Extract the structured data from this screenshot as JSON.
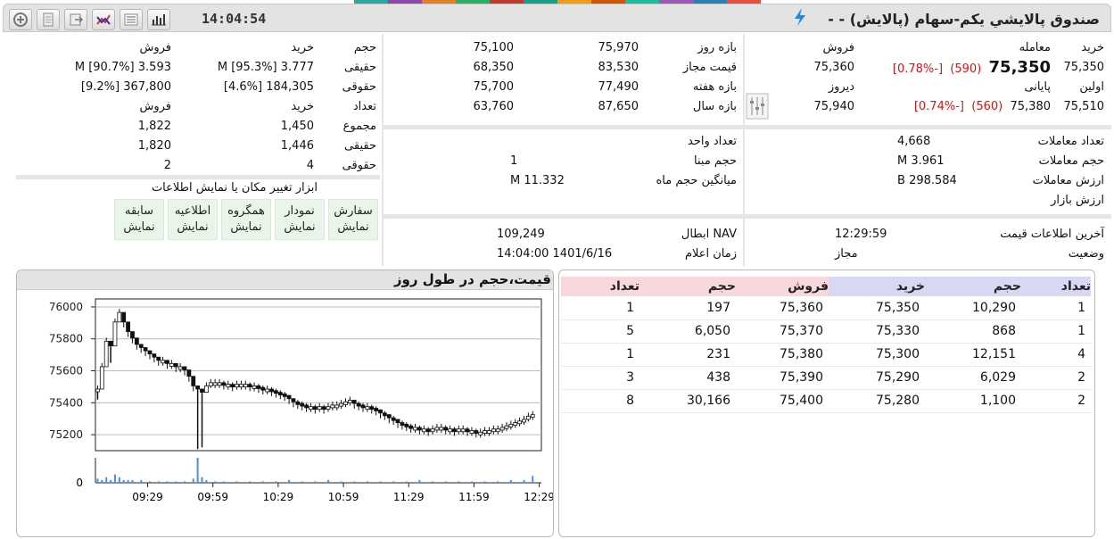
{
  "colors": {
    "accent_stripe": [
      "#2aa7a1",
      "#8e44ad",
      "#e67e22",
      "#27ae60",
      "#c0392b",
      "#16a085",
      "#f39c12",
      "#d35400",
      "#1abc9c",
      "#9b59b6",
      "#2980b9",
      "#e74c3c"
    ],
    "negative": "#dd1111",
    "buy_header": "#d8d8f4",
    "sell_header": "#f8d8dc",
    "show_button": "#e8f5e8"
  },
  "titlebar": {
    "time": "14:04:54",
    "title": "صندوق پالايشي يكم-سهام (پالايش) - -",
    "icons": [
      "add-icon",
      "document-icon",
      "export-icon",
      "chart-compare-icon",
      "list-icon",
      "bar-chart-icon"
    ],
    "bolt_icon": "lightning-icon"
  },
  "price": {
    "labels": {
      "buy": "خرید",
      "trade": "معامله",
      "sell": "فروش",
      "first": "اولین",
      "last": "پایانی",
      "yesterday": "دیروز"
    },
    "buy": "75,350",
    "trade": "75,350",
    "trade_change": "(590)",
    "trade_pct": "[-0.78%]",
    "sell": "75,360",
    "first": "75,510",
    "last": "75,380",
    "last_change": "(560)",
    "last_pct": "[-0.74%]",
    "yesterday": "75,940"
  },
  "ranges": {
    "rows": [
      {
        "label": "بازه روز",
        "v1": "75,970",
        "v2": "75,100"
      },
      {
        "label": "قیمت مجاز",
        "v1": "83,530",
        "v2": "68,350"
      },
      {
        "label": "بازه هفته",
        "v1": "77,490",
        "v2": "75,700"
      },
      {
        "label": "بازه سال",
        "v1": "87,650",
        "v2": "63,760"
      }
    ]
  },
  "clients": {
    "header": {
      "volume": "حجم",
      "buy": "خرید",
      "sell": "فروش"
    },
    "rows": [
      {
        "label": "حقیقی",
        "buy": "3.777 M [95.3%]",
        "sell": "3.593 M [90.7%]"
      },
      {
        "label": "حقوقی",
        "buy": "184,305 [4.6%]",
        "sell": "367,800 [9.2%]"
      }
    ],
    "count_header": {
      "count": "تعداد",
      "buy": "خرید",
      "sell": "فروش"
    },
    "count_rows": [
      {
        "label": "مجموع",
        "buy": "1,450",
        "sell": "1,822"
      },
      {
        "label": "حقیقی",
        "buy": "1,446",
        "sell": "1,820"
      },
      {
        "label": "حقوقی",
        "buy": "4",
        "sell": "2"
      }
    ]
  },
  "tools": {
    "title": "ابزار تغییر مکان یا نمایش اطلاعات",
    "buttons": [
      {
        "name": "سفارش",
        "action": "نمایش"
      },
      {
        "name": "نمودار",
        "action": "نمایش"
      },
      {
        "name": "همگروه",
        "action": "نمایش"
      },
      {
        "name": "اطلاعیه",
        "action": "نمایش"
      },
      {
        "name": "سابقه",
        "action": "نمایش"
      }
    ]
  },
  "trades": {
    "rows": [
      {
        "label": "تعداد معاملات",
        "value": "4,668"
      },
      {
        "label": "حجم معاملات",
        "value": "3.961 M"
      },
      {
        "label": "ارزش معاملات",
        "value": "298.584 B"
      },
      {
        "label": "ارزش بازار",
        "value": ""
      }
    ]
  },
  "units": {
    "rows": [
      {
        "label": "تعداد واحد",
        "value": ""
      },
      {
        "label": "حجم مبنا",
        "value": "1"
      },
      {
        "label": "میانگین حجم ماه",
        "value": "11.332 M"
      }
    ]
  },
  "status": {
    "last_price_label": "آخرین اطلاعات قیمت",
    "last_price_value": "12:29:59",
    "state_label": "وضعیت",
    "state_value": "مجاز"
  },
  "nav": {
    "nav_label": "NAV ابطال",
    "nav_value": "109,249",
    "time_label": "زمان اعلام",
    "time_value": "1401/6/16 14:04:00"
  },
  "orderbook": {
    "headers": {
      "count": "تعداد",
      "volume": "حجم",
      "buy": "خرید",
      "sell": "فروش"
    },
    "rows": [
      {
        "bcount": "1",
        "bvol": "10,290",
        "bprice": "75,350",
        "sprice": "75,360",
        "svol": "197",
        "scount": "1"
      },
      {
        "bcount": "1",
        "bvol": "868",
        "bprice": "75,330",
        "sprice": "75,370",
        "svol": "6,050",
        "scount": "5"
      },
      {
        "bcount": "4",
        "bvol": "12,151",
        "bprice": "75,300",
        "sprice": "75,380",
        "svol": "231",
        "scount": "1"
      },
      {
        "bcount": "2",
        "bvol": "6,029",
        "bprice": "75,290",
        "sprice": "75,390",
        "svol": "438",
        "scount": "3"
      },
      {
        "bcount": "2",
        "bvol": "1,100",
        "bprice": "75,280",
        "sprice": "75,400",
        "svol": "30,166",
        "scount": "8"
      }
    ]
  },
  "chart_data": {
    "type": "candlestick",
    "title": "قیمت،حجم در طول روز",
    "xlabel": "",
    "ylabel": "",
    "ylim": [
      75100,
      76050
    ],
    "y_ticks": [
      76000,
      75800,
      75600,
      75400,
      75200
    ],
    "x_ticks": [
      "09:29",
      "09:59",
      "10:29",
      "10:59",
      "11:29",
      "11:59",
      "12:29"
    ],
    "volume_ticks": [
      0
    ],
    "grid": true,
    "x_range_minutes": [
      545,
      750
    ],
    "prices": [
      [
        546,
        75480
      ],
      [
        548,
        75620
      ],
      [
        550,
        75780
      ],
      [
        552,
        75750
      ],
      [
        554,
        75900
      ],
      [
        556,
        75960
      ],
      [
        558,
        75900
      ],
      [
        560,
        75840
      ],
      [
        562,
        75800
      ],
      [
        564,
        75760
      ],
      [
        566,
        75740
      ],
      [
        568,
        75720
      ],
      [
        570,
        75700
      ],
      [
        572,
        75680
      ],
      [
        574,
        75660
      ],
      [
        576,
        75660
      ],
      [
        578,
        75640
      ],
      [
        580,
        75640
      ],
      [
        582,
        75620
      ],
      [
        584,
        75620
      ],
      [
        586,
        75600
      ],
      [
        588,
        75560
      ],
      [
        590,
        75500
      ],
      [
        592,
        75480
      ],
      [
        594,
        75460
      ],
      [
        596,
        75500
      ],
      [
        598,
        75520
      ],
      [
        600,
        75520
      ],
      [
        602,
        75520
      ],
      [
        604,
        75510
      ],
      [
        606,
        75510
      ],
      [
        608,
        75500
      ],
      [
        610,
        75510
      ],
      [
        612,
        75510
      ],
      [
        614,
        75510
      ],
      [
        616,
        75500
      ],
      [
        618,
        75500
      ],
      [
        620,
        75490
      ],
      [
        622,
        75480
      ],
      [
        624,
        75480
      ],
      [
        626,
        75470
      ],
      [
        628,
        75460
      ],
      [
        630,
        75450
      ],
      [
        632,
        75440
      ],
      [
        634,
        75420
      ],
      [
        636,
        75400
      ],
      [
        638,
        75390
      ],
      [
        640,
        75380
      ],
      [
        642,
        75370
      ],
      [
        644,
        75370
      ],
      [
        646,
        75360
      ],
      [
        648,
        75370
      ],
      [
        650,
        75360
      ],
      [
        652,
        75370
      ],
      [
        654,
        75380
      ],
      [
        656,
        75380
      ],
      [
        658,
        75390
      ],
      [
        660,
        75400
      ],
      [
        662,
        75410
      ],
      [
        664,
        75390
      ],
      [
        666,
        75380
      ],
      [
        668,
        75370
      ],
      [
        670,
        75370
      ],
      [
        672,
        75360
      ],
      [
        674,
        75350
      ],
      [
        676,
        75330
      ],
      [
        678,
        75320
      ],
      [
        680,
        75300
      ],
      [
        682,
        75290
      ],
      [
        684,
        75270
      ],
      [
        686,
        75260
      ],
      [
        688,
        75250
      ],
      [
        690,
        75240
      ],
      [
        692,
        75240
      ],
      [
        694,
        75230
      ],
      [
        696,
        75230
      ],
      [
        698,
        75220
      ],
      [
        700,
        75230
      ],
      [
        702,
        75240
      ],
      [
        704,
        75240
      ],
      [
        706,
        75230
      ],
      [
        708,
        75230
      ],
      [
        710,
        75220
      ],
      [
        712,
        75230
      ],
      [
        714,
        75230
      ],
      [
        716,
        75220
      ],
      [
        718,
        75220
      ],
      [
        720,
        75210
      ],
      [
        722,
        75210
      ],
      [
        724,
        75220
      ],
      [
        726,
        75220
      ],
      [
        728,
        75230
      ],
      [
        730,
        75230
      ],
      [
        732,
        75240
      ],
      [
        734,
        75250
      ],
      [
        736,
        75260
      ],
      [
        738,
        75270
      ],
      [
        740,
        75280
      ],
      [
        742,
        75290
      ],
      [
        744,
        75310
      ],
      [
        746,
        75320
      ]
    ],
    "spikes_low": [
      [
        546,
        75420
      ],
      [
        552,
        75650
      ],
      [
        592,
        75110
      ],
      [
        594,
        75120
      ]
    ],
    "volumes": [
      [
        546,
        3
      ],
      [
        548,
        2
      ],
      [
        550,
        4
      ],
      [
        552,
        2
      ],
      [
        554,
        6
      ],
      [
        556,
        4
      ],
      [
        558,
        2
      ],
      [
        560,
        2
      ],
      [
        562,
        2
      ],
      [
        566,
        2
      ],
      [
        570,
        1
      ],
      [
        574,
        1
      ],
      [
        578,
        1
      ],
      [
        582,
        1
      ],
      [
        586,
        1
      ],
      [
        590,
        3
      ],
      [
        592,
        18
      ],
      [
        594,
        4
      ],
      [
        596,
        2
      ],
      [
        600,
        1
      ],
      [
        604,
        1
      ],
      [
        610,
        1
      ],
      [
        616,
        1
      ],
      [
        622,
        1
      ],
      [
        628,
        1
      ],
      [
        634,
        2
      ],
      [
        640,
        1
      ],
      [
        646,
        1
      ],
      [
        652,
        2
      ],
      [
        658,
        1
      ],
      [
        664,
        1
      ],
      [
        670,
        1
      ],
      [
        676,
        1
      ],
      [
        682,
        1
      ],
      [
        688,
        1
      ],
      [
        694,
        2
      ],
      [
        700,
        1
      ],
      [
        706,
        1
      ],
      [
        712,
        1
      ],
      [
        718,
        1
      ],
      [
        724,
        1
      ],
      [
        730,
        1
      ],
      [
        736,
        2
      ],
      [
        742,
        2
      ],
      [
        746,
        5
      ]
    ]
  }
}
